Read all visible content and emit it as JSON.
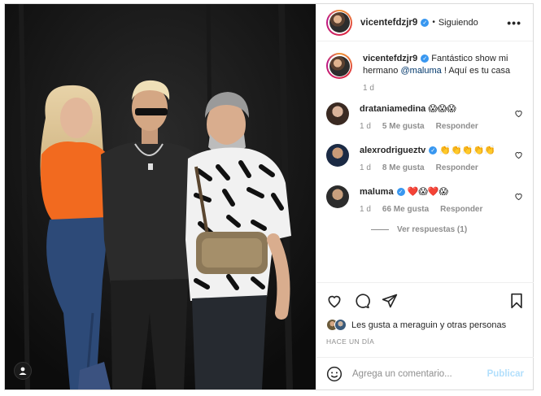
{
  "post": {
    "username": "vicentefdzjr9",
    "separator": "•",
    "follow_status": "Siguiendo",
    "more_label": "•••"
  },
  "caption": {
    "username": "vicentefdzjr9",
    "text_before": " Fantástico show mi hermano ",
    "mention": "@maluma",
    "text_after": " ! Aquí es tu casa",
    "time": "1 d"
  },
  "comments": [
    {
      "username": "drataniamedina",
      "text": "😱😱😱",
      "time": "1 d",
      "likes": "5 Me gusta",
      "reply": "Responder",
      "verified": false
    },
    {
      "username": "alexrodrigueztv",
      "text": "👏👏👏👏👏",
      "time": "1 d",
      "likes": "8 Me gusta",
      "reply": "Responder",
      "verified": true
    },
    {
      "username": "maluma",
      "text": "❤️😱❤️😱",
      "time": "1 d",
      "likes": "66 Me gusta",
      "reply": "Responder",
      "verified": true
    }
  ],
  "view_replies": "Ver respuestas (1)",
  "likes_text": "Les gusta a meraguin y otras personas",
  "post_date": "HACE UN DÍA",
  "comment_input": {
    "placeholder": "Agrega un comentario...",
    "publish": "Publicar"
  },
  "icons": [
    "heart-icon",
    "comment-icon",
    "share-icon",
    "bookmark-icon",
    "emoji-icon",
    "user-tag-icon",
    "more-icon"
  ],
  "colors": {
    "verified": "#3897f0",
    "mention": "#00376b",
    "muted": "#8e8e8e",
    "publish_disabled": "#b2dffc"
  }
}
